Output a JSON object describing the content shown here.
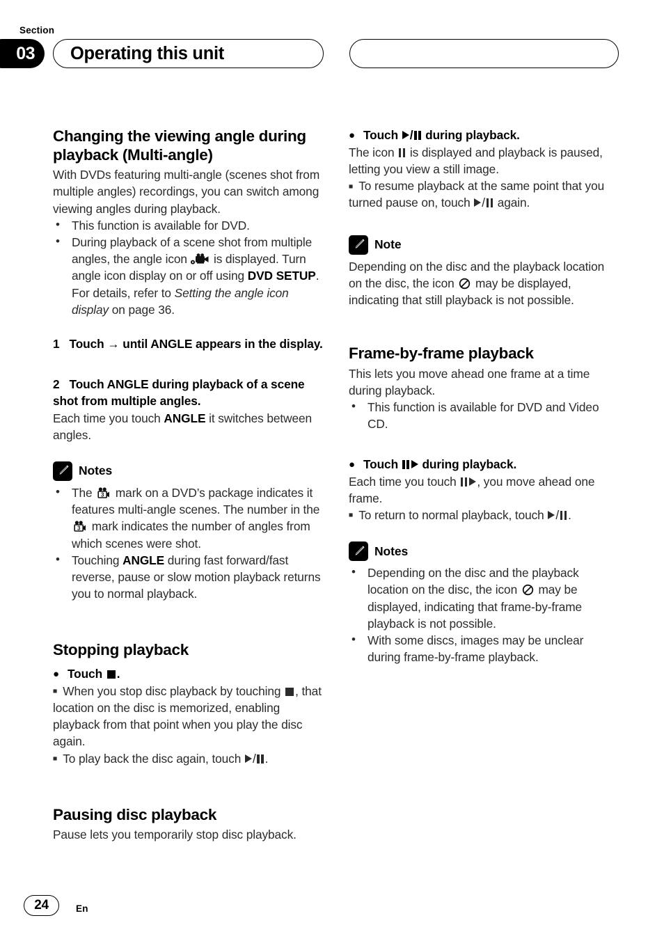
{
  "header": {
    "section_label": "Section",
    "section_number": "03",
    "title": "Operating this unit",
    "right_pill_text": ""
  },
  "footer": {
    "page_number": "24",
    "language_code": "En"
  },
  "left_column": {
    "heading_multiangle": "Changing the viewing angle during playback (Multi-angle)",
    "intro": "With DVDs featuring multi-angle (scenes shot from multiple angles) recordings, you can switch among viewing angles during playback.",
    "bullets": [
      "This function is available for DVD.",
      "During playback of a scene shot from multiple angles, the angle icon"
    ],
    "bullet2_after_icon": "is displayed. Turn angle icon display on or off using",
    "bullet2_keyword": "DVD SETUP",
    "bullet2_tail_1": ". For details, refer to",
    "bullet2_italic": "Setting the angle icon display",
    "bullet2_tail_2": "on page 36.",
    "step1_num": "1",
    "step1_a": "Touch",
    "step1_b": "until ANGLE appears in the display.",
    "step2_num": "2",
    "step2": "Touch ANGLE during playback of a scene shot from multiple angles.",
    "step2_body_a": "Each time you touch",
    "step2_body_kw": "ANGLE",
    "step2_body_b": "it switches between angles.",
    "notes_title": "Notes",
    "note1_a": "The",
    "note1_b": "mark on a DVD’s package indicates it features multi-angle scenes. The number in the",
    "note1_c": "mark indicates the number of angles from which scenes were shot.",
    "note2_a": "Touching",
    "note2_kw": "ANGLE",
    "note2_b": "during fast forward/fast reverse, pause or slow motion playback returns you to normal playback.",
    "heading_stopping": "Stopping playback",
    "stop_instr": "Touch",
    "stop_instr_tail": ".",
    "stop_note1_a": "When you stop disc playback by touching",
    "stop_note1_b": ", that location on the disc is memorized, enabling playback from that point when you play the disc again.",
    "stop_note2_a": "To play back the disc again, touch",
    "stop_note2_b": ".",
    "heading_pausing": "Pausing disc playback",
    "pausing_body": "Pause lets you temporarily stop disc playback."
  },
  "right_column": {
    "pause_instr_a": "Touch",
    "pause_instr_b": "during playback.",
    "pause_body_a": "The icon",
    "pause_body_b": "is displayed and playback is paused, letting you view a still image.",
    "pause_note_a": "To resume playback at the same point that you turned pause on, touch",
    "pause_note_b": "again.",
    "note_title": "Note",
    "note_a": "Depending on the disc and the playback location on the disc, the icon",
    "note_b": "may be displayed, indicating that still playback is not possible.",
    "heading_frame": "Frame-by-frame playback",
    "frame_intro": "This lets you move ahead one frame at a time during playback.",
    "frame_bullet": "This function is available for DVD and Video CD.",
    "frame_instr_a": "Touch",
    "frame_instr_b": "during playback.",
    "frame_body_a": "Each time you touch",
    "frame_body_b": ", you move ahead one frame.",
    "frame_note_a": "To return to normal playback, touch",
    "frame_note_b": ".",
    "notes_title": "Notes",
    "fnote1_a": "Depending on the disc and the playback location on the disc, the icon",
    "fnote1_b": "may be displayed, indicating that frame-by-frame playback is not possible.",
    "fnote2": "With some discs, images may be unclear during frame-by-frame playback."
  },
  "icons": {
    "pencil": "pencil-icon",
    "video_camera": "video-camera-icon",
    "angle_mark": "multi-angle-mark-icon",
    "prohibited": "prohibited-icon",
    "play": "play-icon",
    "pause": "pause-icon",
    "stop": "stop-icon",
    "arrow_right": "→"
  },
  "colors": {
    "ink": "#1a1a1a",
    "body_text": "#2b2b2b",
    "badge_bg": "#000000",
    "page_bg": "#ffffff"
  }
}
